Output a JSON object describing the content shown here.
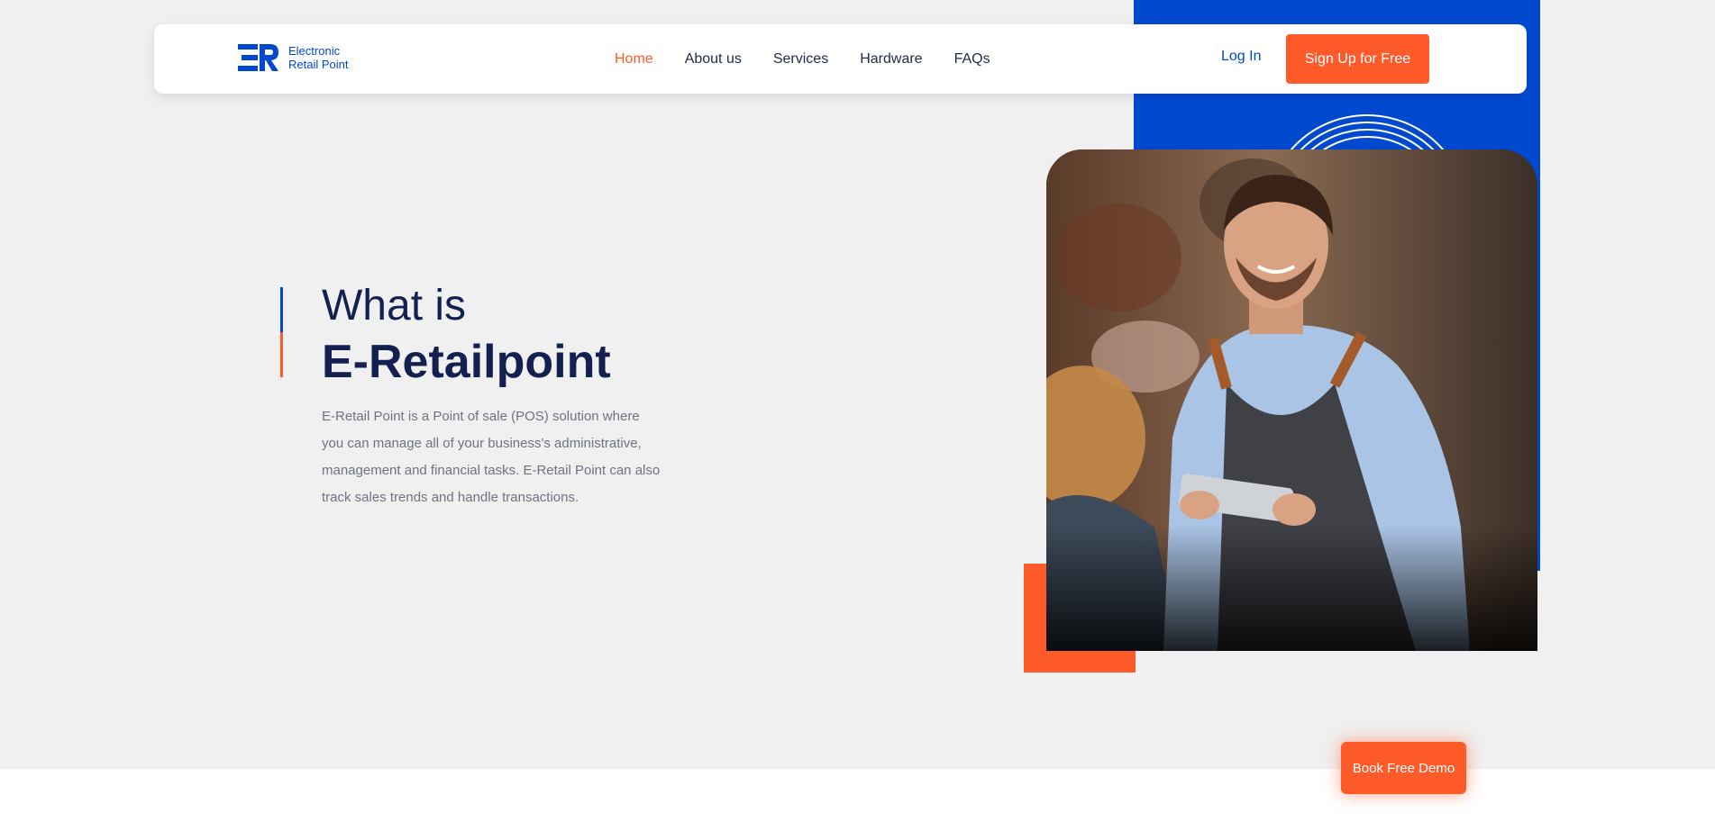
{
  "brand": {
    "name_line1": "Electronic",
    "name_line2": "Retail Point",
    "logo_icon": "er-logo-icon",
    "primary_color": "#0049cf",
    "accent_color": "#ff5a29"
  },
  "nav": {
    "items": [
      {
        "label": "Home",
        "active": true
      },
      {
        "label": "About us",
        "active": false
      },
      {
        "label": "Services",
        "active": false
      },
      {
        "label": "Hardware",
        "active": false
      },
      {
        "label": "FAQs",
        "active": false
      }
    ],
    "login_label": "Log In",
    "signup_label": "Sign Up for Free"
  },
  "hero": {
    "heading_line1": "What is",
    "heading_line2": "E-Retailpoint",
    "description": "E-Retail Point is a Point of sale (POS) solution where you can manage all of your business's administrative, management and financial tasks. E-Retail Point can also track sales trends and handle transactions.",
    "image_subject": "smiling waiter holding tablet"
  },
  "floating": {
    "demo_label": "Book Free Demo"
  }
}
